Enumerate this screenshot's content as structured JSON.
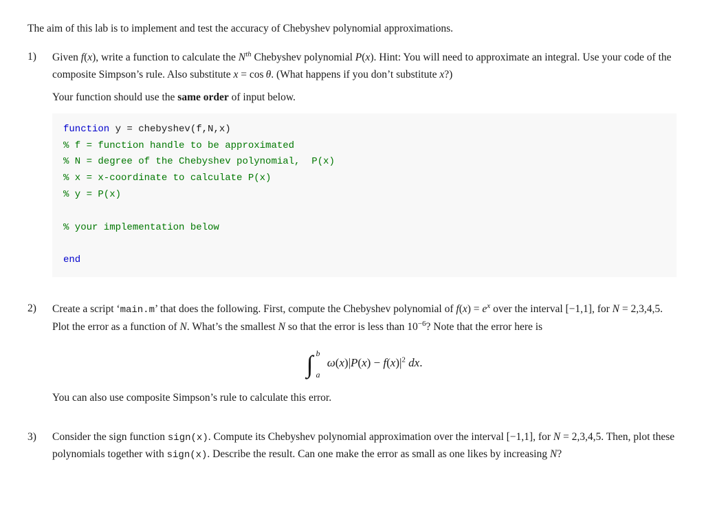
{
  "intro": "The aim of this lab is to implement and test the accuracy of Chebyshev polynomial approximations.",
  "questions": [
    {
      "number": "1)",
      "paragraphs": [
        "Given f(x), write a function to calculate the Nth Chebyshev polynomial P(x). Hint: You will need to approximate an integral. Use your code of the composite Simpson’s rule. Also substitute x = cosθ. (What happens if you don’t substitute x?)",
        "Your function should use the same order of input below."
      ],
      "code": [
        "function y = chebyshev(f,N,x)",
        "% f = function handle to be approximated",
        "% N = degree of the Chebyshev polynomial, P(x)",
        "% x = x-coordinate to calculate P(x)",
        "% y = P(x)",
        "",
        "% your implementation below",
        "",
        "end"
      ]
    },
    {
      "number": "2)",
      "text": "Create a script ‘main.m’ that does the following. First, compute the Chebyshev polynomial of f(x) = ex over the interval [−1,1], for N = 2,3,4,5. Plot the error as a function of N. What’s the smallest N so that the error is less than 10−6? Note that the error here is",
      "integral_note": "You can also use composite Simpson’s rule to calculate this error."
    },
    {
      "number": "3)",
      "text": "Consider the sign function sign(x). Compute its Chebyshev polynomial approximation over the interval [−1,1], for N = 2,3,4,5. Then, plot these polynomials together with sign(x). Describe the result. Can one make the error as small as one likes by increasing N?"
    }
  ],
  "labels": {
    "same_order": "same order",
    "bold_label": "same order"
  }
}
